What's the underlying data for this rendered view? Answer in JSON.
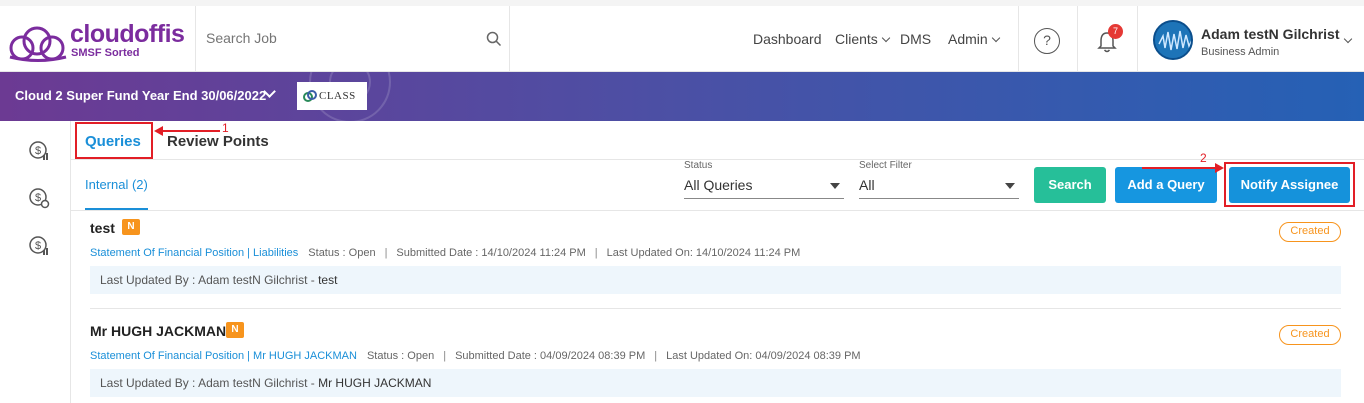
{
  "brand": {
    "name": "cloudoffis",
    "tagline": "SMSF Sorted",
    "color": "#7b2c9e"
  },
  "header": {
    "search_placeholder": "Search Job",
    "nav": {
      "dashboard": "Dashboard",
      "clients": "Clients",
      "dms": "DMS",
      "admin": "Admin"
    },
    "notifications_count": "7",
    "user_name": "Adam testN Gilchrist",
    "user_role": "Business Admin"
  },
  "banner": {
    "fund_title": "Cloud 2 Super Fund Year End 30/06/2022",
    "class_logo_text": "CLASS"
  },
  "sidebar": {
    "icons": [
      "dollar-chart-icon",
      "dollar-gear-icon",
      "dollar-chart-icon"
    ]
  },
  "tabs": {
    "queries": "Queries",
    "review_points": "Review Points"
  },
  "subtab": {
    "internal": "Internal (2)"
  },
  "filters": {
    "status_label": "Status",
    "status_value": "All Queries",
    "filter_label": "Select Filter",
    "filter_value": "All"
  },
  "buttons": {
    "search": "Search",
    "add_query": "Add a Query",
    "notify_assignee": "Notify Assignee"
  },
  "annotations": {
    "one": "1",
    "two": "2"
  },
  "queries": [
    {
      "title": "test",
      "badge": "N",
      "path": "Statement Of Financial Position | Liabilities",
      "status": "Status : Open",
      "submitted": "Submitted Date : 14/10/2024 11:24 PM",
      "updated_on": "Last Updated On: 14/10/2024 11:24 PM",
      "updated_by_label": "Last Updated By : Adam testN Gilchrist - ",
      "updated_by_value": "test",
      "state": "Created"
    },
    {
      "title": "Mr HUGH JACKMAN",
      "badge": "N",
      "path": "Statement Of Financial Position | Mr HUGH JACKMAN",
      "status": "Status : Open",
      "submitted": "Submitted Date : 04/09/2024 08:39 PM",
      "updated_on": "Last Updated On: 04/09/2024 08:39 PM",
      "updated_by_label": "Last Updated By : Adam testN Gilchrist - ",
      "updated_by_value": "Mr HUGH JACKMAN",
      "state": "Created"
    }
  ],
  "colors": {
    "accent_blue": "#1a8fd8",
    "search_green": "#26bf99",
    "add_blue": "#1696e0",
    "notify_blue": "#1592db",
    "badge_orange": "#f7941d",
    "highlight_red": "#e21e26"
  }
}
